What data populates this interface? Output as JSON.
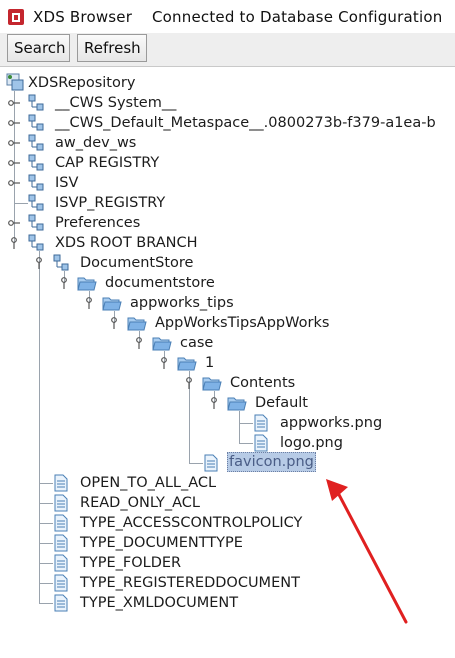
{
  "window": {
    "app_name": "XDS Browser",
    "connection_status": "Connected to Database Configuration"
  },
  "toolbar": {
    "search_label": "Search",
    "refresh_label": "Refresh"
  },
  "tree": {
    "root": "XDSRepository",
    "items": [
      {
        "label": "__CWS System__"
      },
      {
        "label": "__CWS_Default_Metaspace__.0800273b-f379-a1ea-b"
      },
      {
        "label": "aw_dev_ws"
      },
      {
        "label": "CAP REGISTRY"
      },
      {
        "label": "ISV"
      },
      {
        "label": "ISVP_REGISTRY"
      },
      {
        "label": "Preferences"
      },
      {
        "label": "XDS ROOT BRANCH"
      },
      {
        "label": "DocumentStore"
      },
      {
        "label": "documentstore"
      },
      {
        "label": "appworks_tips"
      },
      {
        "label": "AppWorksTipsAppWorks"
      },
      {
        "label": "case"
      },
      {
        "label": "1"
      },
      {
        "label": "Contents"
      },
      {
        "label": "Default"
      },
      {
        "label": "appworks.png"
      },
      {
        "label": "logo.png"
      },
      {
        "label": "favicon.png"
      },
      {
        "label": "OPEN_TO_ALL_ACL"
      },
      {
        "label": "READ_ONLY_ACL"
      },
      {
        "label": "TYPE_ACCESSCONTROLPOLICY"
      },
      {
        "label": "TYPE_DOCUMENTTYPE"
      },
      {
        "label": "TYPE_FOLDER"
      },
      {
        "label": "TYPE_REGISTEREDDOCUMENT"
      },
      {
        "label": "TYPE_XMLDOCUMENT"
      }
    ]
  },
  "colors": {
    "selection_bg": "#b7cbe6",
    "annotation_arrow": "#e02020",
    "folder_blue": "#7fb2e6"
  }
}
